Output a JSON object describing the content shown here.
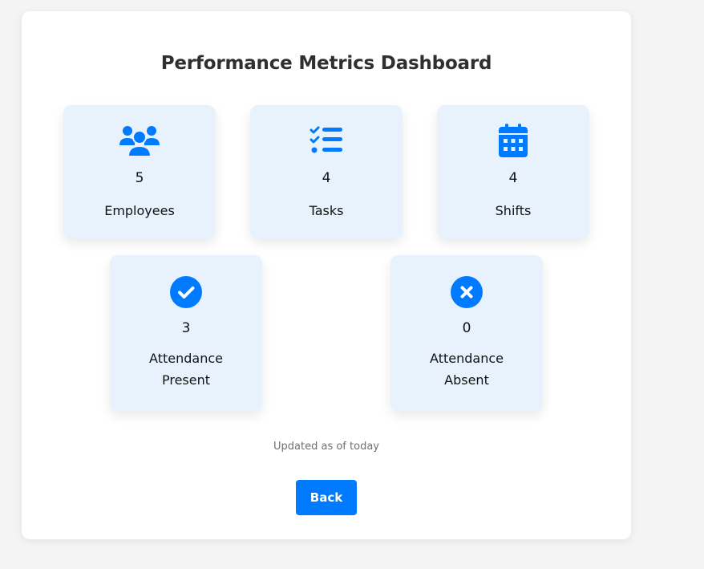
{
  "dashboard": {
    "title": "Performance Metrics Dashboard",
    "accent_color": "#007bff",
    "card_background": "#e7f2fd",
    "metrics": [
      {
        "icon": "users-icon",
        "value": "5",
        "label": "Employees"
      },
      {
        "icon": "tasks-list-icon",
        "value": "4",
        "label": "Tasks"
      },
      {
        "icon": "calendar-icon",
        "value": "4",
        "label": "Shifts"
      },
      {
        "icon": "check-circle-icon",
        "value": "3",
        "label_lines": [
          "Attendance",
          "Present"
        ]
      },
      {
        "icon": "x-circle-icon",
        "value": "0",
        "label_lines": [
          "Attendance",
          "Absent"
        ]
      }
    ],
    "updated_text": "Updated as of today",
    "back_label": "Back"
  }
}
